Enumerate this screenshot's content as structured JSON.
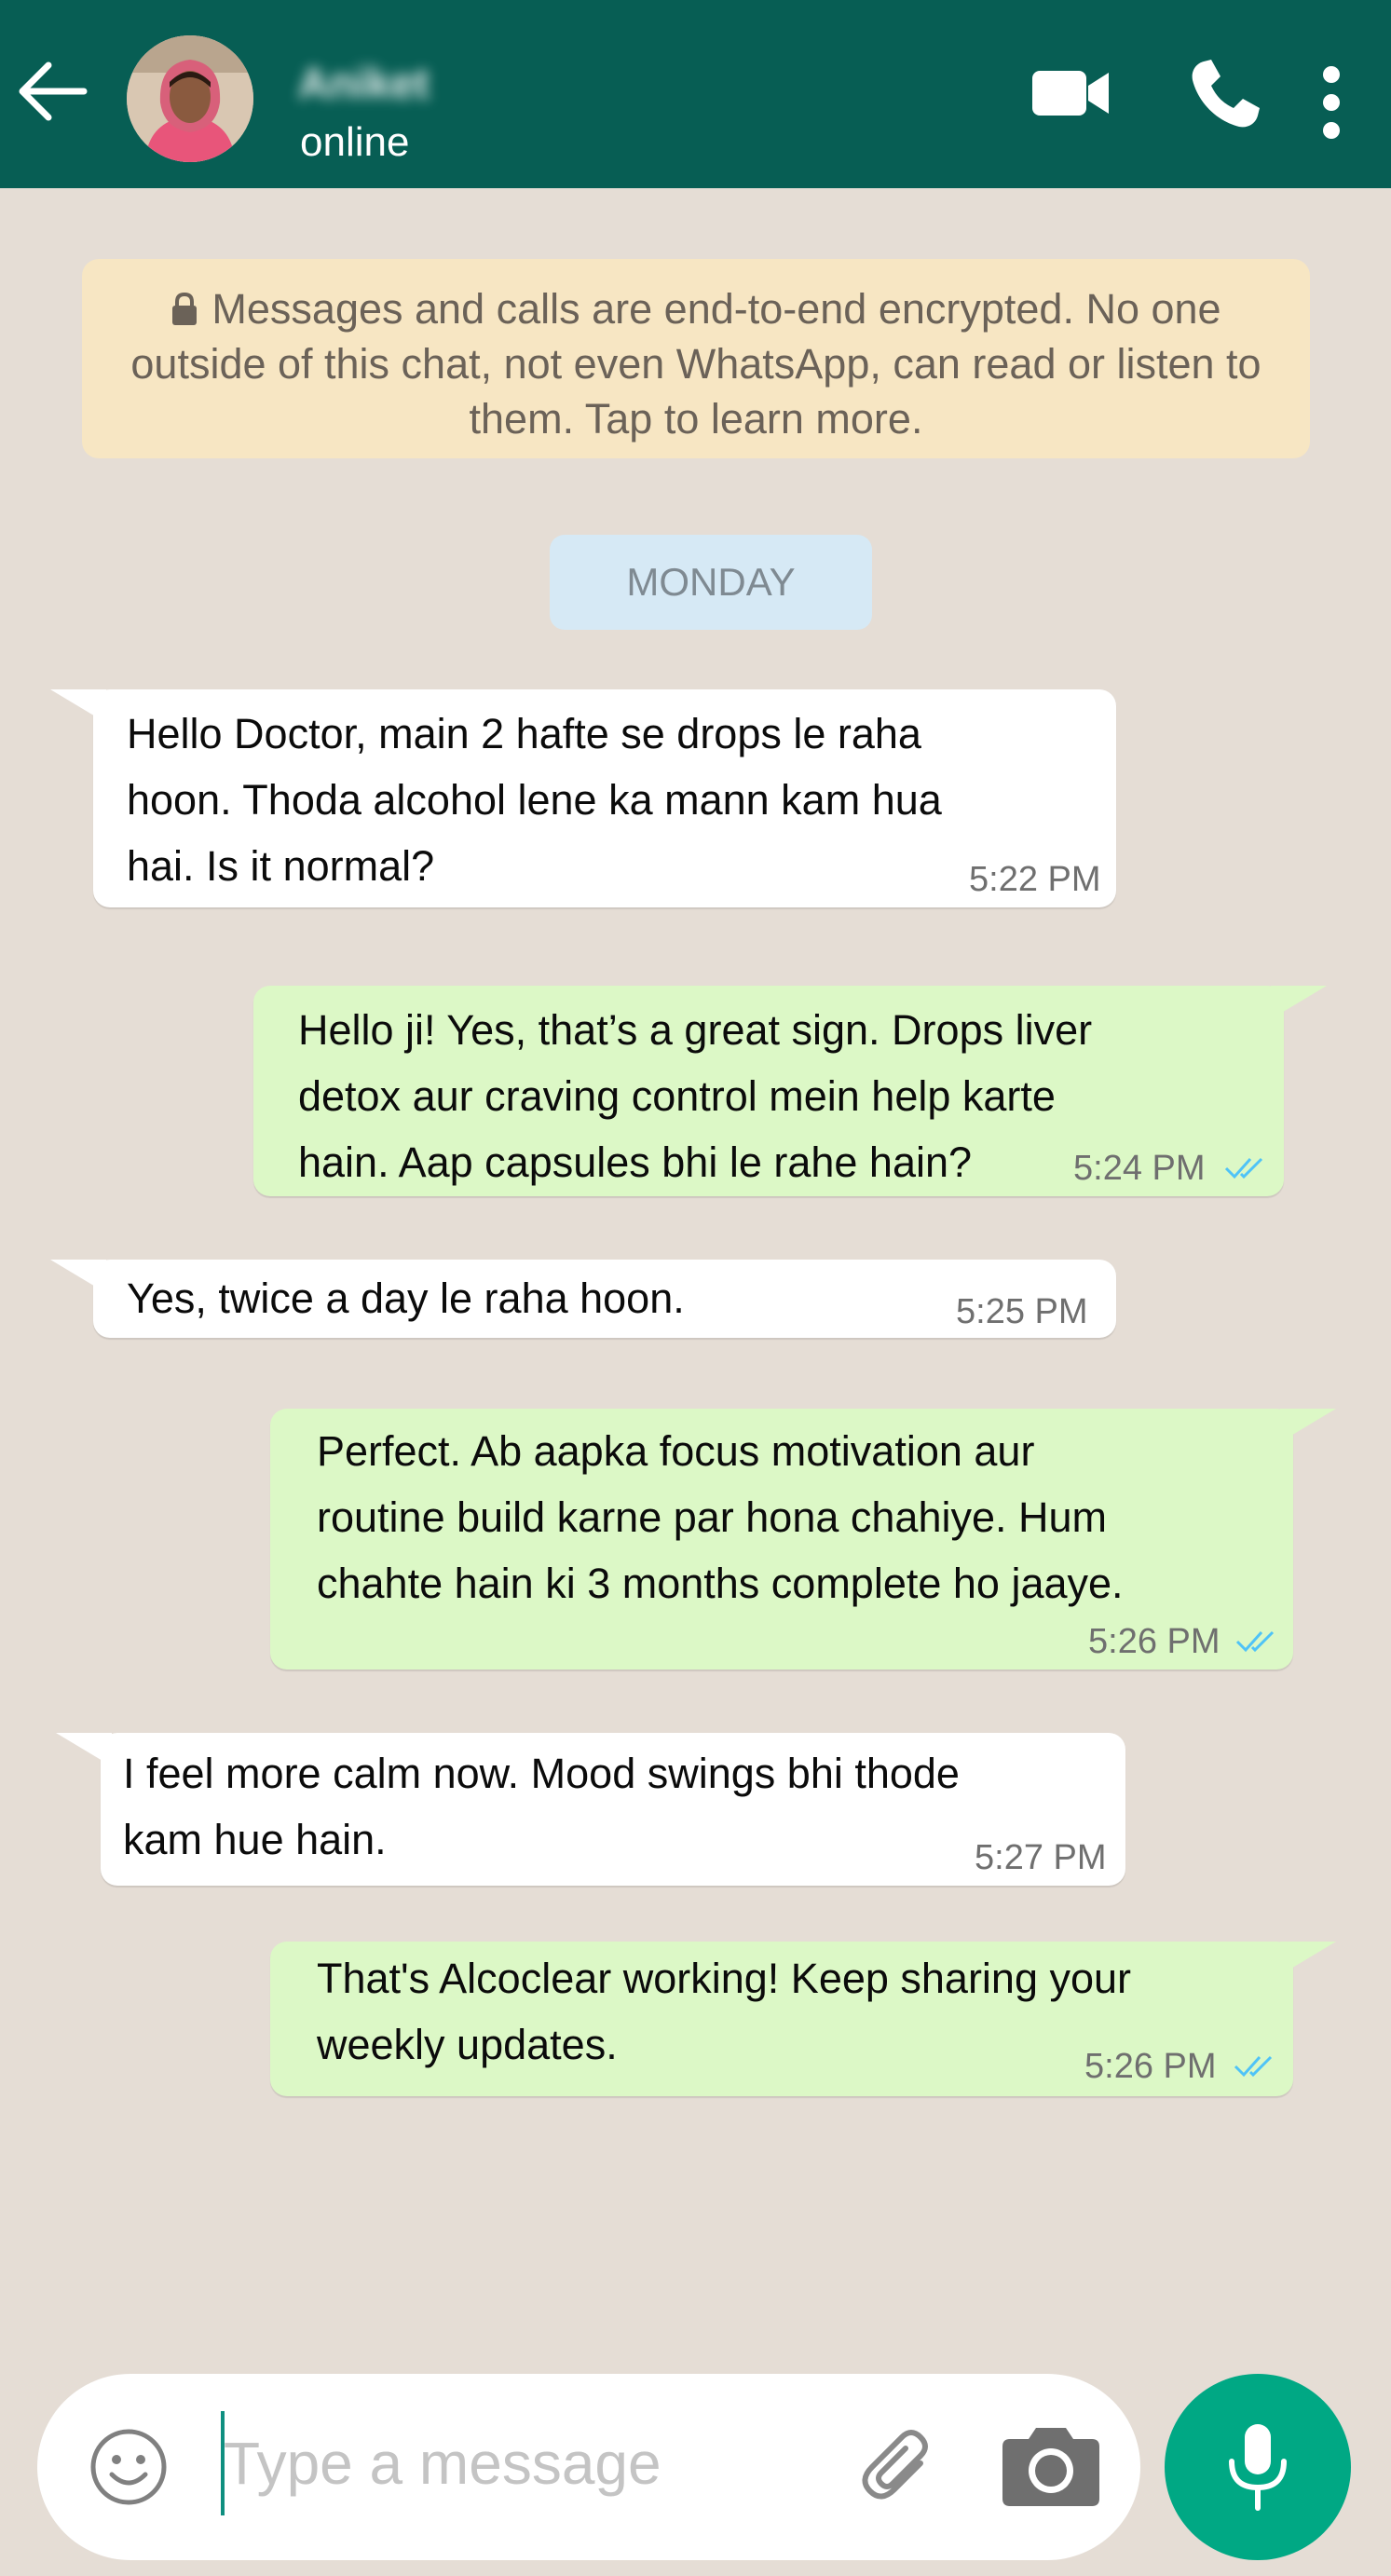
{
  "colors": {
    "header": "#075e54",
    "chat_background": "#e5ddd5",
    "incoming_bubble": "#ffffff",
    "outgoing_bubble": "#dcf8c6",
    "encryption_notice": "#f7e6c3",
    "read_ticks": "#4fc3f7",
    "mic_button": "#00a884"
  },
  "header": {
    "back_icon": "arrow-left-icon",
    "contact_name": "Aniket",
    "status": "online",
    "video_call_icon": "video-camera-icon",
    "voice_call_icon": "phone-icon",
    "menu_icon": "more-vertical-icon"
  },
  "encryption_notice": {
    "icon": "lock-icon",
    "text": "Messages and calls are end-to-end encrypted. No one outside of this chat, not even WhatsApp, can read or listen to them. Tap to learn more."
  },
  "day_separator": "MONDAY",
  "messages": [
    {
      "direction": "in",
      "text": "Hello Doctor, main 2 hafte se drops le raha\nhoon. Thoda alcohol lene ka mann kam hua\nhai. Is it normal?",
      "time": "5:22 PM"
    },
    {
      "direction": "out",
      "text": "Hello ji! Yes, that’s a great sign. Drops liver\ndetox aur craving control mein help karte\nhain. Aap capsules bhi le rahe hain?",
      "time": "5:24 PM",
      "status": "read"
    },
    {
      "direction": "in",
      "text": "Yes, twice a day le raha hoon.",
      "time": "5:25 PM"
    },
    {
      "direction": "out",
      "text": "Perfect. Ab aapka focus motivation aur\nroutine build karne par hona chahiye. Hum\nchahte hain ki 3 months complete ho jaaye.",
      "time": "5:26 PM",
      "status": "read"
    },
    {
      "direction": "in",
      "text": "I feel more calm now. Mood swings bhi thode\nkam hue hain.",
      "time": "5:27 PM"
    },
    {
      "direction": "out",
      "text": "That's Alcoclear working! Keep sharing your\nweekly updates.",
      "time": "5:26 PM",
      "status": "read"
    }
  ],
  "input_bar": {
    "emoji_icon": "smiley-icon",
    "placeholder": "Type a message",
    "attach_icon": "paperclip-icon",
    "camera_icon": "camera-icon",
    "mic_icon": "microphone-icon"
  }
}
